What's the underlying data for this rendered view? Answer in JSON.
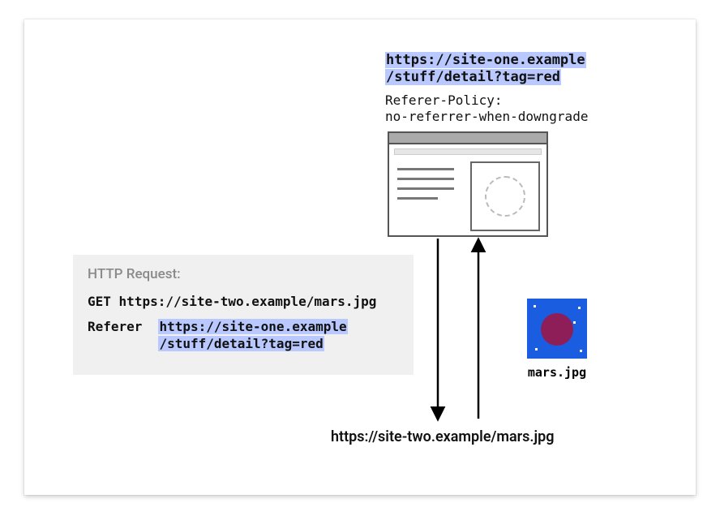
{
  "siteOneUrl": {
    "line1": "https://site-one.example",
    "line2": "/stuff/detail?tag=red"
  },
  "refererPolicy": "Referer-Policy:\nno-referrer-when-downgrade",
  "httpRequest": {
    "heading": "HTTP Request:",
    "method": "GET",
    "url": "https://site-two.example/mars.jpg",
    "refererHeaderName": "Referer",
    "refererValue": {
      "line1": "https://site-one.example",
      "line2": "/stuff/detail?tag=red"
    }
  },
  "mars": {
    "caption": "mars.jpg"
  },
  "siteTwoUrl": "https://site-two.example/mars.jpg"
}
